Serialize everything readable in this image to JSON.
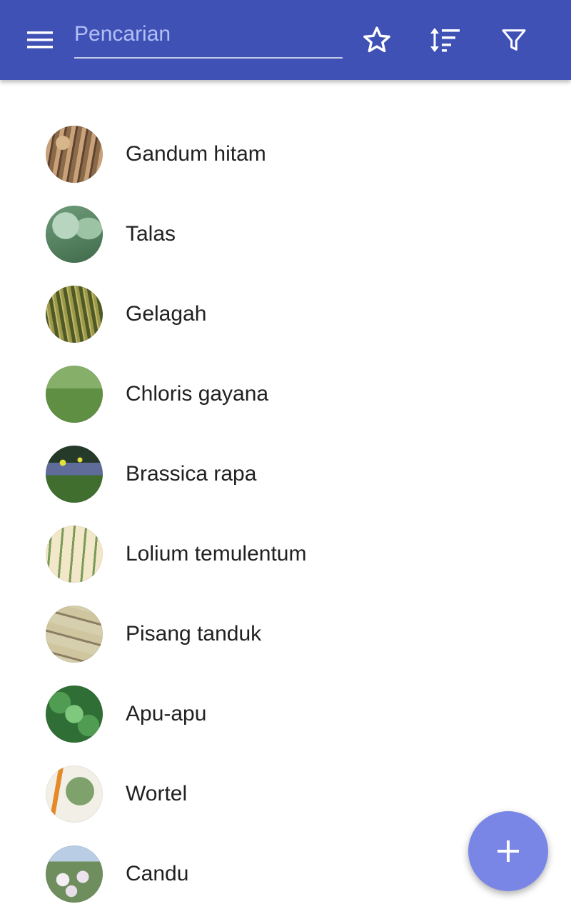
{
  "toolbar": {
    "background_color": "#3f51b5",
    "menu_icon": "menu-icon",
    "search": {
      "placeholder": "Pencarian",
      "value": ""
    },
    "actions": [
      {
        "icon": "star-outline-icon"
      },
      {
        "icon": "sort-icon"
      },
      {
        "icon": "filter-icon"
      }
    ]
  },
  "list": {
    "items": [
      {
        "label": "Gandum hitam"
      },
      {
        "label": "Talas"
      },
      {
        "label": "Gelagah"
      },
      {
        "label": "Chloris gayana"
      },
      {
        "label": "Brassica rapa"
      },
      {
        "label": "Lolium temulentum"
      },
      {
        "label": "Pisang tanduk"
      },
      {
        "label": "Apu-apu"
      },
      {
        "label": "Wortel"
      },
      {
        "label": "Candu"
      }
    ]
  },
  "fab": {
    "icon": "plus-icon",
    "color": "#7986e6"
  }
}
